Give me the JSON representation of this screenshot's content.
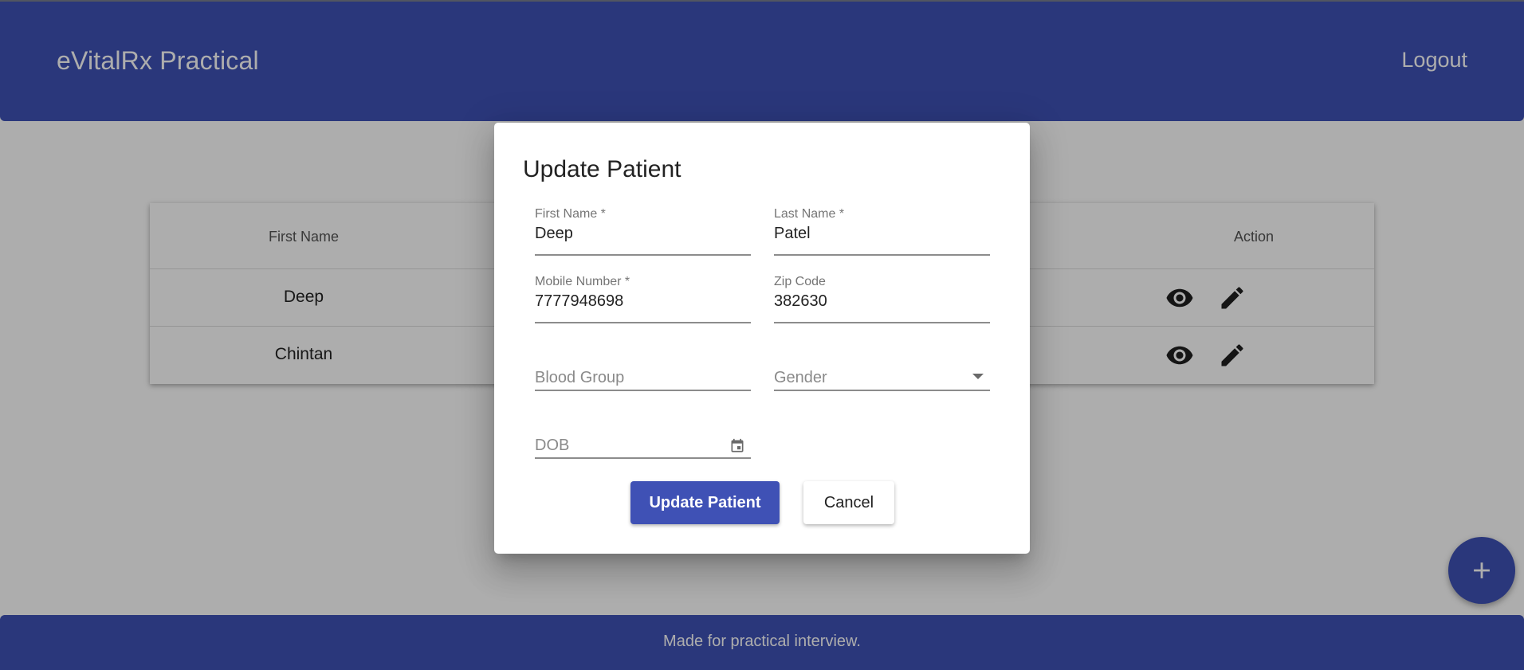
{
  "header": {
    "app_title": "eVitalRx Practical",
    "logout_label": "Logout"
  },
  "table": {
    "columns": {
      "first_name": "First Name",
      "action": "Action"
    },
    "rows": [
      {
        "first_name": "Deep",
        "actions": [
          "eye-icon",
          "pencil-icon"
        ]
      },
      {
        "first_name": "Chintan",
        "actions": [
          "eye-icon",
          "pencil-icon"
        ]
      }
    ]
  },
  "dialog": {
    "title": "Update Patient",
    "fields": {
      "first_name": {
        "label": "First Name *",
        "value": "Deep"
      },
      "last_name": {
        "label": "Last Name *",
        "value": "Patel"
      },
      "mobile": {
        "label": "Mobile Number *",
        "value": "7777948698"
      },
      "zip": {
        "label": "Zip Code",
        "value": "382630"
      },
      "blood_group": {
        "placeholder": "Blood Group"
      },
      "gender": {
        "placeholder": "Gender",
        "icon": "chevron-down-icon"
      },
      "dob": {
        "placeholder": "DOB",
        "icon": "calendar-icon"
      }
    },
    "submit_label": "Update Patient",
    "cancel_label": "Cancel"
  },
  "fab": {
    "icon": "plus-icon"
  },
  "footer": {
    "text": "Made for practical interview."
  },
  "colors": {
    "primary": "#3f51b5",
    "backdrop": "rgba(0,0,0,0.32)"
  }
}
